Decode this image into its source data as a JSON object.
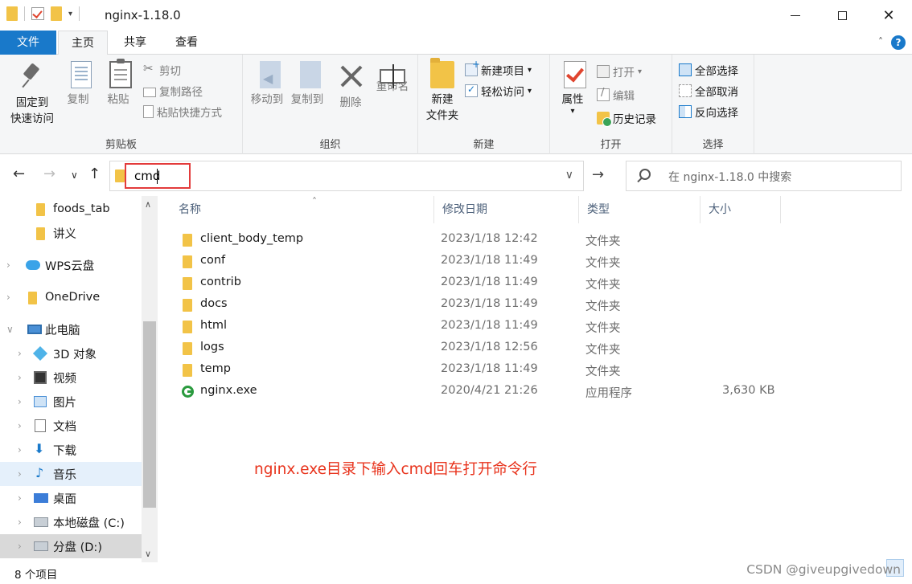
{
  "window": {
    "title": "nginx-1.18.0",
    "controls": {
      "minimize": "minimize",
      "maximize": "maximize",
      "close": "✕"
    }
  },
  "tabs": [
    {
      "label": "文件",
      "active": false
    },
    {
      "label": "主页",
      "active": true
    },
    {
      "label": "共享",
      "active": false
    },
    {
      "label": "查看",
      "active": false
    }
  ],
  "ribbon": {
    "clipboard": {
      "label": "剪贴板",
      "pin_line1": "固定到",
      "pin_line2": "快速访问",
      "copy": "复制",
      "paste": "粘贴",
      "cut": "剪切",
      "copy_path": "复制路径",
      "paste_shortcut": "粘贴快捷方式"
    },
    "organize": {
      "label": "组织",
      "move_to": "移动到",
      "copy_to": "复制到",
      "delete": "删除",
      "rename": "重命名"
    },
    "new": {
      "label": "新建",
      "new_folder_line1": "新建",
      "new_folder_line2": "文件夹",
      "new_item": "新建项目",
      "easy_access": "轻松访问"
    },
    "open": {
      "label": "打开",
      "properties": "属性",
      "open": "打开",
      "edit": "编辑",
      "history": "历史记录"
    },
    "select": {
      "label": "选择",
      "select_all": "全部选择",
      "select_none": "全部取消",
      "invert": "反向选择"
    }
  },
  "address": {
    "value": "cmd",
    "search_placeholder": "在 nginx-1.18.0 中搜索"
  },
  "nav_pane": {
    "items": [
      {
        "label": "foods_tab",
        "icon": "folder-icon"
      },
      {
        "label": "讲义",
        "icon": "folder-icon"
      },
      {
        "label": "WPS云盘",
        "icon": "cloud-icon"
      },
      {
        "label": "OneDrive",
        "icon": "folder-icon"
      },
      {
        "label": "此电脑",
        "icon": "computer-icon"
      },
      {
        "label": "3D 对象",
        "icon": "cube-icon"
      },
      {
        "label": "视频",
        "icon": "video-icon"
      },
      {
        "label": "图片",
        "icon": "picture-icon"
      },
      {
        "label": "文档",
        "icon": "document-icon"
      },
      {
        "label": "下载",
        "icon": "download-icon"
      },
      {
        "label": "音乐",
        "icon": "music-icon"
      },
      {
        "label": "桌面",
        "icon": "desktop-icon"
      },
      {
        "label": "本地磁盘 (C:)",
        "icon": "disk-icon"
      },
      {
        "label": "分盘 (D:)",
        "icon": "disk-icon"
      }
    ]
  },
  "columns": {
    "name": "名称",
    "date": "修改日期",
    "type": "类型",
    "size": "大小"
  },
  "files": [
    {
      "name": "client_body_temp",
      "date": "2023/1/18 12:42",
      "type": "文件夹",
      "size": ""
    },
    {
      "name": "conf",
      "date": "2023/1/18 11:49",
      "type": "文件夹",
      "size": ""
    },
    {
      "name": "contrib",
      "date": "2023/1/18 11:49",
      "type": "文件夹",
      "size": ""
    },
    {
      "name": "docs",
      "date": "2023/1/18 11:49",
      "type": "文件夹",
      "size": ""
    },
    {
      "name": "html",
      "date": "2023/1/18 11:49",
      "type": "文件夹",
      "size": ""
    },
    {
      "name": "logs",
      "date": "2023/1/18 12:56",
      "type": "文件夹",
      "size": ""
    },
    {
      "name": "temp",
      "date": "2023/1/18 11:49",
      "type": "文件夹",
      "size": ""
    },
    {
      "name": "nginx.exe",
      "date": "2020/4/21 21:26",
      "type": "应用程序",
      "size": "3,630 KB"
    }
  ],
  "annotation": "nginx.exe目录下输入cmd回车打开命令行",
  "status": {
    "item_count": "8 个项目"
  },
  "watermark": "CSDN @giveupgivedown",
  "colors": {
    "accent": "#1979ca",
    "annotation_red": "#e8331c",
    "folder_yellow": "#f2c347"
  }
}
